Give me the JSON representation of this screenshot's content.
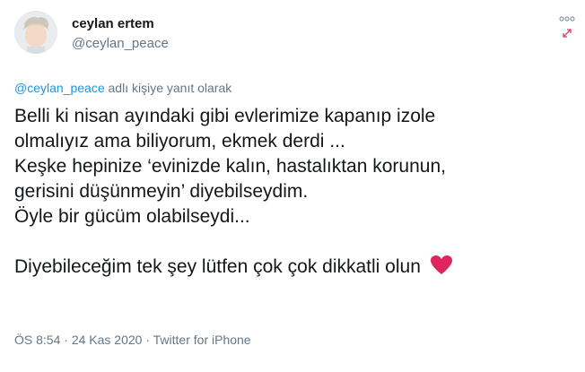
{
  "author": {
    "display_name": "ceylan ertem",
    "handle": "@ceylan_peace",
    "avatar_icon": "profile-photo"
  },
  "reply": {
    "mention": "@ceylan_peace",
    "suffix": " adlı kişiye yanıt olarak"
  },
  "tweet_lines": [
    "Belli ki nisan ayındaki gibi evlerimize kapanıp izole",
    "olmalıyız ama biliyorum, ekmek derdi ...",
    "Keşke hepinize ‘evinizde kalın, hastalıktan korunun,",
    "gerisini düşünmeyin’ diyebilseydim.",
    "Öyle bir gücüm olabilseydi...",
    "Diyebileceğim tek şey lütfen çok çok dikkatli olun"
  ],
  "footer": {
    "time": "ÖS 8:54",
    "separator1": " · ",
    "date": "24 Kas 2020",
    "separator2": " · ",
    "source": "Twitter for iPhone"
  },
  "icons": {
    "more": "more-options-icon",
    "expand": "expand-icon",
    "heart": "red-heart-emoji"
  },
  "colors": {
    "text": "#14171a",
    "secondary": "#657786",
    "link": "#1b95e0",
    "heart": "#e0245e"
  }
}
